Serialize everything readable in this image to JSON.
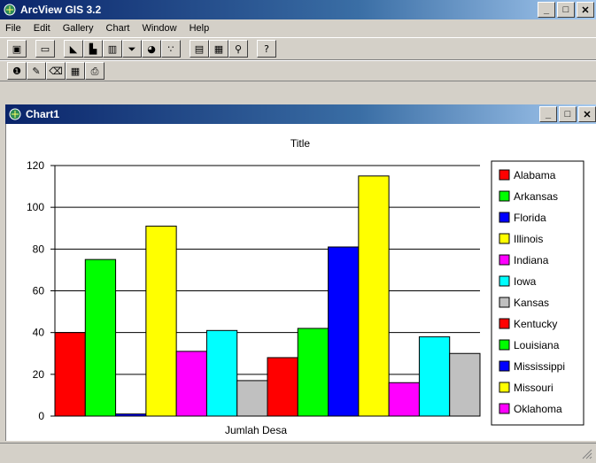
{
  "app": {
    "title": "ArcView GIS 3.2"
  },
  "window_buttons": {
    "minimize": "_",
    "restore": "□",
    "close": "✕"
  },
  "menu": [
    "File",
    "Edit",
    "Gallery",
    "Chart",
    "Window",
    "Help"
  ],
  "toolbar1": [
    {
      "icon": "save-icon",
      "glyph": "▣"
    },
    {
      "icon": "properties-icon",
      "glyph": "▭"
    },
    {
      "icon": "area-chart-icon",
      "glyph": "◣"
    },
    {
      "icon": "bar-chart-icon",
      "glyph": "▙"
    },
    {
      "icon": "column-chart-icon",
      "glyph": "▥"
    },
    {
      "icon": "line-chart-icon",
      "glyph": "⏷"
    },
    {
      "icon": "pie-chart-icon",
      "glyph": "◕"
    },
    {
      "icon": "xy-chart-icon",
      "glyph": "∵"
    },
    {
      "icon": "series-rows-icon",
      "glyph": "▤"
    },
    {
      "icon": "series-columns-icon",
      "glyph": "▦"
    },
    {
      "icon": "find-icon",
      "glyph": "⚲"
    },
    {
      "icon": "help-icon",
      "glyph": "?"
    }
  ],
  "toolbar2": [
    {
      "icon": "identify-icon",
      "glyph": "❶"
    },
    {
      "icon": "edit-pencil-icon",
      "glyph": "✎"
    },
    {
      "icon": "erase-icon",
      "glyph": "⌫"
    },
    {
      "icon": "element-properties-icon",
      "glyph": "▦"
    },
    {
      "icon": "print-icon",
      "glyph": "⎙"
    }
  ],
  "child_window": {
    "title": "Chart1"
  },
  "colors": {
    "red": "#ff0000",
    "green": "#00ff00",
    "blue": "#0000ff",
    "yellow": "#ffff00",
    "magenta": "#ff00ff",
    "cyan": "#00ffff",
    "gray": "#c0c0c0"
  },
  "chart_data": {
    "type": "bar",
    "title": "Title",
    "xlabel": "Jumlah Desa",
    "ylabel": "",
    "ylim": [
      0,
      120
    ],
    "yticks": [
      0,
      20,
      40,
      60,
      80,
      100,
      120
    ],
    "grid": true,
    "legend_position": "right",
    "series": [
      {
        "name": "Alabama",
        "value": 40,
        "color": "#ff0000"
      },
      {
        "name": "Arkansas",
        "value": 75,
        "color": "#00ff00"
      },
      {
        "name": "Florida",
        "value": 1,
        "color": "#0000ff"
      },
      {
        "name": "Illinois",
        "value": 91,
        "color": "#ffff00"
      },
      {
        "name": "Indiana",
        "value": 31,
        "color": "#ff00ff"
      },
      {
        "name": "Iowa",
        "value": 41,
        "color": "#00ffff"
      },
      {
        "name": "Kansas",
        "value": 17,
        "color": "#c0c0c0"
      },
      {
        "name": "Kentucky",
        "value": 28,
        "color": "#ff0000"
      },
      {
        "name": "Louisiana",
        "value": 42,
        "color": "#00ff00"
      },
      {
        "name": "Mississippi",
        "value": 81,
        "color": "#0000ff"
      },
      {
        "name": "Missouri",
        "value": 115,
        "color": "#ffff00"
      },
      {
        "name": "Oklahoma",
        "value": 16,
        "color": "#ff00ff"
      },
      {
        "name": "",
        "value": 38,
        "color": "#00ffff"
      },
      {
        "name": "",
        "value": 30,
        "color": "#c0c0c0"
      }
    ]
  }
}
